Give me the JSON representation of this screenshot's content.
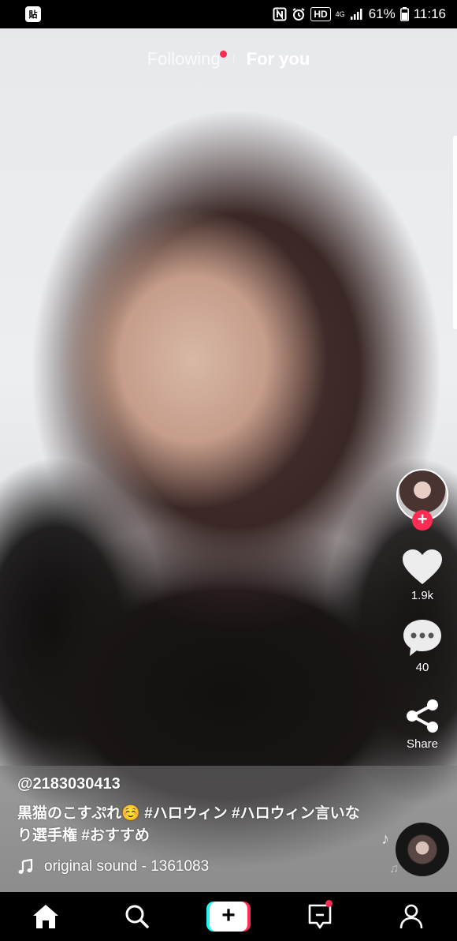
{
  "status_bar": {
    "app_badge": "貼",
    "network": "4G",
    "battery": "61%",
    "time": "11:16",
    "hd": "HD"
  },
  "top_tabs": {
    "following": "Following",
    "for_you": "For you"
  },
  "rail": {
    "likes": "1.9k",
    "comments": "40",
    "share": "Share"
  },
  "caption": {
    "username": "@2183030413",
    "description": "黒猫のこすぷれ☺️ #ハロウィン #ハロウィン言いなり選手権 #おすすめ",
    "sound": "original sound - 1361083"
  },
  "colors": {
    "accent": "#fe2c55",
    "cyan": "#25f4ee"
  },
  "icons": {
    "home": "home-icon",
    "discover": "search-icon",
    "create": "plus-icon",
    "inbox": "inbox-icon",
    "profile": "profile-icon"
  }
}
